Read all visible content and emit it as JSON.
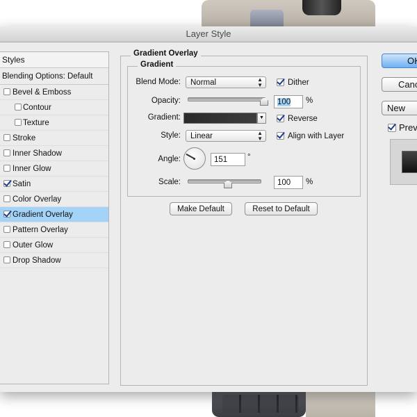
{
  "window": {
    "title": "Layer Style"
  },
  "styles_panel": {
    "header": "Styles",
    "blending_options": "Blending Options: Default",
    "items": [
      {
        "label": "Bevel & Emboss",
        "checked": false,
        "sub": false,
        "selected": false
      },
      {
        "label": "Contour",
        "checked": false,
        "sub": true,
        "selected": false
      },
      {
        "label": "Texture",
        "checked": false,
        "sub": true,
        "selected": false
      },
      {
        "label": "Stroke",
        "checked": false,
        "sub": false,
        "selected": false
      },
      {
        "label": "Inner Shadow",
        "checked": false,
        "sub": false,
        "selected": false
      },
      {
        "label": "Inner Glow",
        "checked": false,
        "sub": false,
        "selected": false
      },
      {
        "label": "Satin",
        "checked": true,
        "sub": false,
        "selected": false
      },
      {
        "label": "Color Overlay",
        "checked": false,
        "sub": false,
        "selected": false
      },
      {
        "label": "Gradient Overlay",
        "checked": true,
        "sub": false,
        "selected": true
      },
      {
        "label": "Pattern Overlay",
        "checked": false,
        "sub": false,
        "selected": false
      },
      {
        "label": "Outer Glow",
        "checked": false,
        "sub": false,
        "selected": false
      },
      {
        "label": "Drop Shadow",
        "checked": false,
        "sub": false,
        "selected": false
      }
    ]
  },
  "gradient_overlay": {
    "section_title": "Gradient Overlay",
    "group_title": "Gradient",
    "blend_mode_label": "Blend Mode:",
    "blend_mode_value": "Normal",
    "dither_label": "Dither",
    "dither_checked": true,
    "opacity_label": "Opacity:",
    "opacity_value": "100",
    "opacity_unit": "%",
    "opacity_level": 1.0,
    "gradient_label": "Gradient:",
    "reverse_label": "Reverse",
    "reverse_checked": true,
    "style_label": "Style:",
    "style_value": "Linear",
    "align_label": "Align with Layer",
    "align_checked": true,
    "angle_label": "Angle:",
    "angle_value": "151",
    "angle_unit": "°",
    "scale_label": "Scale:",
    "scale_value": "100",
    "scale_unit": "%",
    "scale_level": 0.5,
    "make_default": "Make Default",
    "reset_default": "Reset to Default"
  },
  "right_panel": {
    "ok": "OK",
    "cancel": "Cancel",
    "new_style": "New Style...",
    "preview_label": "Preview",
    "preview_checked": true
  },
  "colors": {
    "selection": "#a3d3f6",
    "ok_button": "#6fb0f2",
    "dialog_bg": "#ececec"
  }
}
